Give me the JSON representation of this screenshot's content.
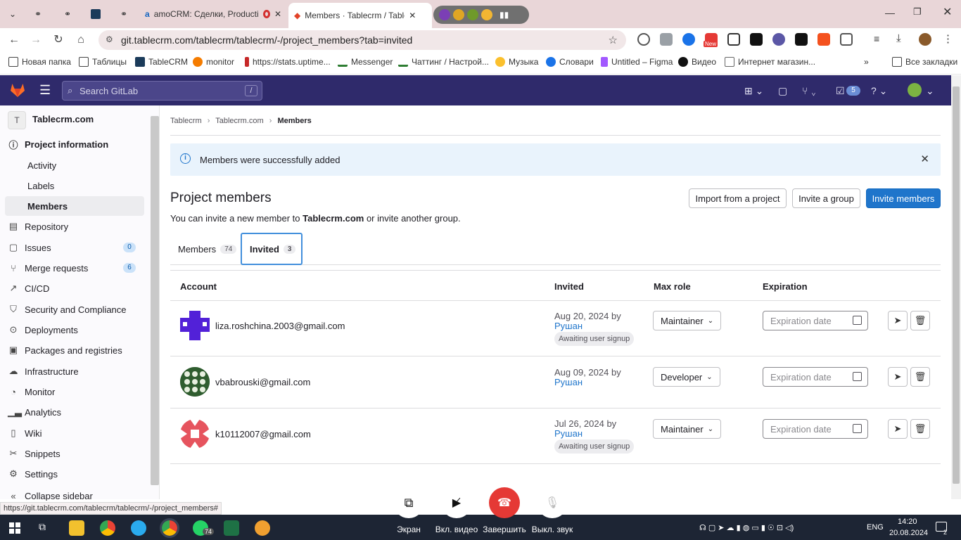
{
  "browser": {
    "tabs": [
      {
        "label": "amoCRM: Сделки, Producti"
      },
      {
        "label": "Members · Tablecrm / Tablecrm"
      }
    ],
    "url": "git.tablecrm.com/tablecrm/tablecrm/-/project_members?tab=invited",
    "new_badge": "New",
    "bookmarks": [
      "Новая папка",
      "Таблицы",
      "TableCRM",
      "monitor",
      "https://stats.uptime...",
      "Messenger",
      "Чаттинг / Настрой...",
      "Музыка",
      "Словари",
      "Untitled – Figma",
      "Видео",
      "Интернет магазин..."
    ],
    "all_bookmarks": "Все закладки"
  },
  "gitlab": {
    "search_placeholder": "Search GitLab",
    "search_shortcut": "/",
    "todo_count": "5"
  },
  "sidebar": {
    "project_initial": "T",
    "project_name": "Tablecrm.com",
    "items": [
      {
        "label": "Project information",
        "icon": "info-icon"
      },
      {
        "label": "Activity"
      },
      {
        "label": "Labels"
      },
      {
        "label": "Members"
      },
      {
        "label": "Repository",
        "icon": "repository-icon"
      },
      {
        "label": "Issues",
        "icon": "issues-icon",
        "badge": "0"
      },
      {
        "label": "Merge requests",
        "icon": "merge-request-icon",
        "badge": "6"
      },
      {
        "label": "CI/CD",
        "icon": "rocket-icon"
      },
      {
        "label": "Security and Compliance",
        "icon": "shield-icon"
      },
      {
        "label": "Deployments",
        "icon": "deployments-icon"
      },
      {
        "label": "Packages and registries",
        "icon": "package-icon"
      },
      {
        "label": "Infrastructure",
        "icon": "cloud-icon"
      },
      {
        "label": "Monitor",
        "icon": "monitor-icon"
      },
      {
        "label": "Analytics",
        "icon": "chart-icon"
      },
      {
        "label": "Wiki",
        "icon": "book-icon"
      },
      {
        "label": "Snippets",
        "icon": "snippet-icon"
      },
      {
        "label": "Settings",
        "icon": "gear-icon"
      }
    ],
    "collapse": "Collapse sidebar"
  },
  "breadcrumb": [
    "Tablecrm",
    "Tablecrm.com",
    "Members"
  ],
  "alert": "Members were successfully added",
  "page": {
    "title": "Project members",
    "desc_prefix": "You can invite a new member to ",
    "desc_project": "Tablecrm.com",
    "desc_suffix": " or invite another group.",
    "import_btn": "Import from a project",
    "invite_group_btn": "Invite a group",
    "invite_members_btn": "Invite members"
  },
  "tabs": [
    {
      "label": "Members",
      "count": "74"
    },
    {
      "label": "Invited",
      "count": "3"
    }
  ],
  "table": {
    "headers": [
      "Account",
      "Invited",
      "Max role",
      "Expiration"
    ],
    "rows": [
      {
        "email": "liza.roshchina.2003@gmail.com",
        "date": "Aug 20, 2024 by",
        "by": "Рушан",
        "status": "Awaiting user signup",
        "role": "Maintainer",
        "exp_placeholder": "Expiration date"
      },
      {
        "email": "vbabrouski@gmail.com",
        "date": "Aug 09, 2024 by",
        "by": "Рушан",
        "status": "",
        "role": "Developer",
        "exp_placeholder": "Expiration date"
      },
      {
        "email": "k10112007@gmail.com",
        "date": "Jul 26, 2024 by",
        "by": "Рушан",
        "status": "Awaiting user signup",
        "role": "Maintainer",
        "exp_placeholder": "Expiration date"
      }
    ]
  },
  "status_url": "https://git.tablecrm.com/tablecrm/tablecrm/-/project_members#",
  "call": {
    "labels": [
      "Экран",
      "Вкл. видео",
      "Завершить",
      "Выкл. звук"
    ]
  },
  "taskbar": {
    "telegram_badge": "74",
    "lang": "ENG",
    "time": "14:20",
    "date": "20.08.2024",
    "notif": "2"
  }
}
